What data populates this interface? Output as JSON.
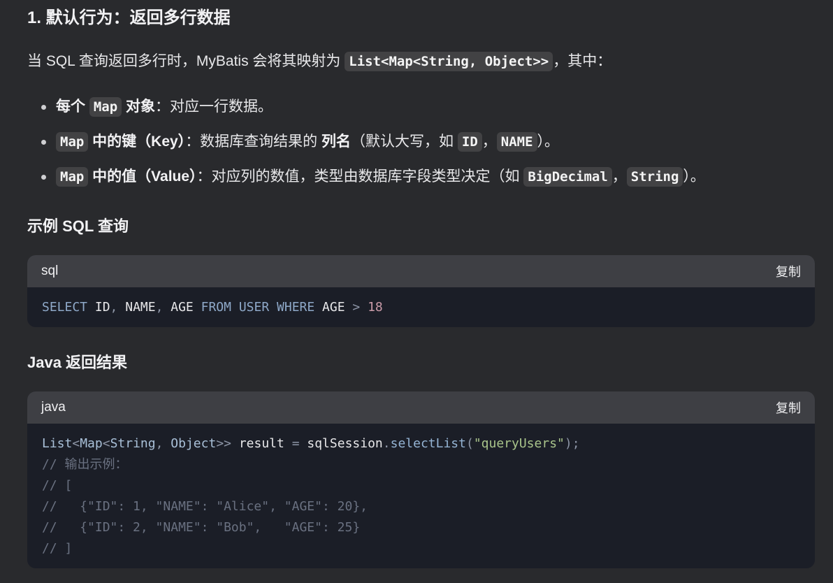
{
  "heading1": "1. 默认行为：返回多行数据",
  "intro": {
    "before": "当 SQL 查询返回多行时，MyBatis 会将其映射为 ",
    "code": "List<Map<String, Object>>",
    "after": "，其中："
  },
  "bullets": [
    {
      "code": "Map",
      "bold_before": "每个 ",
      "bold_after": " 对象",
      "text": "：对应一行数据。"
    },
    {
      "code": "Map",
      "bold": " 中的键（Key）",
      "text1": "：数据库查询结果的 ",
      "bold2": "列名",
      "text2": "（默认大写，如 ",
      "code2": "ID",
      "sep": "，",
      "code3": "NAME",
      "text3": "）。"
    },
    {
      "code": "Map",
      "bold": " 中的值（Value）",
      "text1": "：对应列的数值，类型由数据库字段类型决定（如 ",
      "code2": "BigDecimal",
      "sep": "，",
      "code3": "String",
      "text3": "）。"
    }
  ],
  "heading_sql": "示例 SQL 查询",
  "sql_block": {
    "lang": "sql",
    "copy": "复制",
    "tokens": {
      "select": "SELECT",
      "c1": " ID",
      "comma1": ",",
      "c2": " NAME",
      "comma2": ",",
      "c3": " AGE ",
      "from": "FROM",
      "sp1": " ",
      "user": "USER",
      "sp2": " ",
      "where": "WHERE",
      "c4": " AGE ",
      "gt": ">",
      "sp3": " ",
      "num": "18"
    }
  },
  "heading_java": "Java 返回结果",
  "java_block": {
    "lang": "java",
    "copy": "复制",
    "line1": {
      "list": "List",
      "lt1": "<",
      "map": "Map",
      "lt2": "<",
      "string": "String",
      "comma": ", ",
      "object": "Object",
      "gt": ">>",
      "result": " result ",
      "eq": "=",
      "session": " sqlSession",
      "dot": ".",
      "method": "selectList",
      "paren1": "(",
      "str": "\"queryUsers\"",
      "paren2": ");"
    },
    "comments": [
      "// 输出示例：",
      "// [",
      "//   {\"ID\": 1, \"NAME\": \"Alice\", \"AGE\": 20},",
      "//   {\"ID\": 2, \"NAME\": \"Bob\",   \"AGE\": 25}",
      "// ]"
    ]
  }
}
